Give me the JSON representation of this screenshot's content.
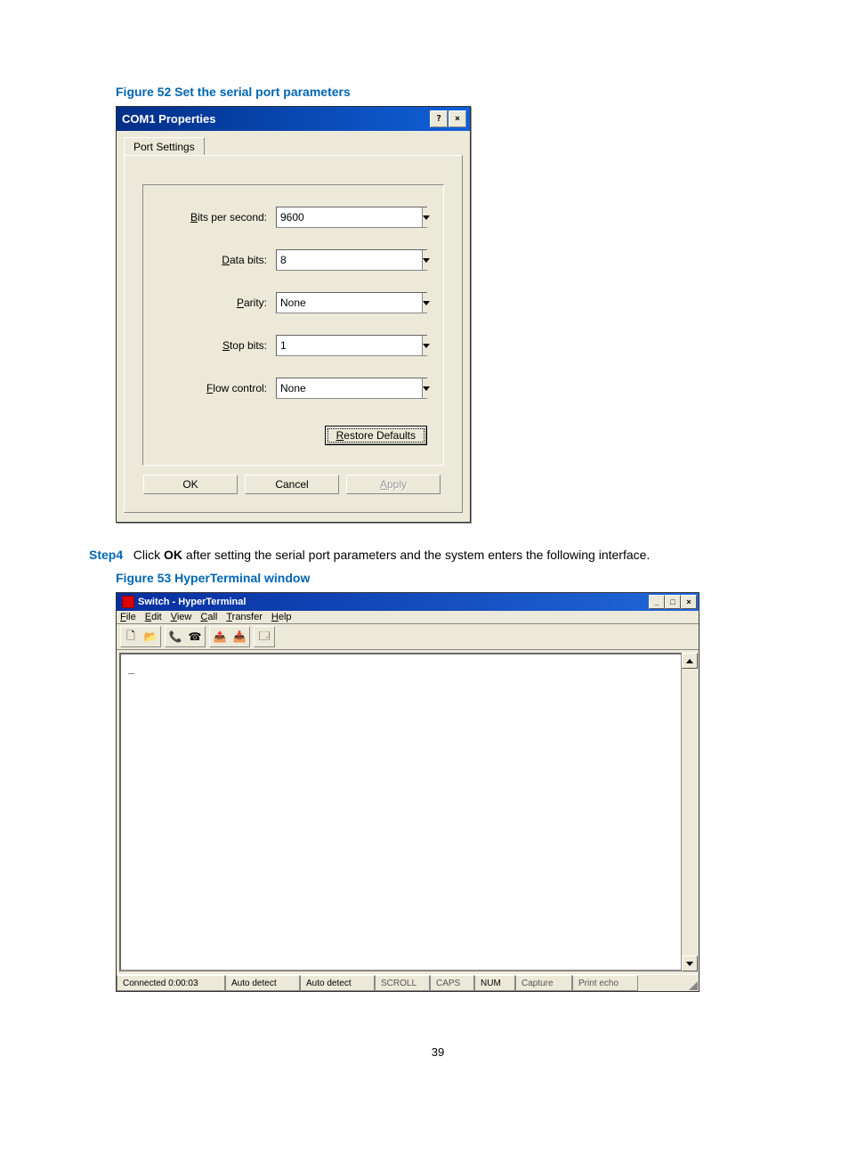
{
  "figure52_caption": "Figure 52 Set the serial port parameters",
  "dialog": {
    "title": "COM1 Properties",
    "help_btn": "?",
    "close_btn": "×",
    "tab": "Port Settings",
    "fields": {
      "bps_label": "Bits per second:",
      "bps_value": "9600",
      "databits_label": "Data bits:",
      "databits_value": "8",
      "parity_label": "Parity:",
      "parity_value": "None",
      "stopbits_label": "Stop bits:",
      "stopbits_value": "1",
      "flow_label": "Flow control:",
      "flow_value": "None"
    },
    "restore_defaults": "Restore Defaults",
    "ok": "OK",
    "cancel": "Cancel",
    "apply": "Apply"
  },
  "step4": {
    "label": "Step4",
    "text_before": "Click ",
    "ok_bold": "OK",
    "text_after": " after setting the serial port parameters and the system enters the following interface."
  },
  "figure53_caption": "Figure 53 HyperTerminal window",
  "ht": {
    "title": "Switch - HyperTerminal",
    "min_btn": "_",
    "max_btn": "□",
    "close_btn": "×",
    "menus": [
      "File",
      "Edit",
      "View",
      "Call",
      "Transfer",
      "Help"
    ],
    "terminal_content": "_",
    "status": {
      "connected": "Connected 0:00:03",
      "detect1": "Auto detect",
      "detect2": "Auto detect",
      "scroll": "SCROLL",
      "caps": "CAPS",
      "num": "NUM",
      "capture": "Capture",
      "printecho": "Print echo"
    }
  },
  "page_number": "39"
}
